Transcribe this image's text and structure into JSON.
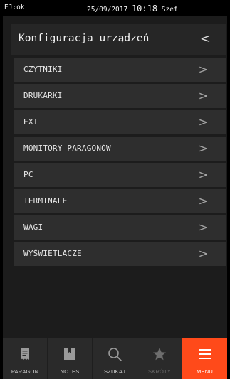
{
  "statusbar": {
    "left": "EJ:ok",
    "date": "25/09/2017",
    "time": "10:18",
    "user": "Szef"
  },
  "header": {
    "title": "Konfiguracja urządzeń",
    "back_glyph": "<"
  },
  "menu": {
    "chevron_glyph": ">",
    "items": [
      {
        "label": "CZYTNIKI"
      },
      {
        "label": "DRUKARKI"
      },
      {
        "label": "EXT"
      },
      {
        "label": "MONITORY PARAGONÓW"
      },
      {
        "label": "PC"
      },
      {
        "label": "TERMINALE"
      },
      {
        "label": "WAGI"
      },
      {
        "label": "WYŚWIETLACZE"
      }
    ]
  },
  "bottom_nav": {
    "active_color": "#ff4a1a",
    "tabs": [
      {
        "label": "PARAGON",
        "icon": "receipt-icon"
      },
      {
        "label": "NOTES",
        "icon": "notes-icon"
      },
      {
        "label": "SZUKAJ",
        "icon": "search-icon"
      },
      {
        "label": "SKRÓTY",
        "icon": "star-icon"
      },
      {
        "label": "MENU",
        "icon": "menu-icon"
      }
    ]
  }
}
